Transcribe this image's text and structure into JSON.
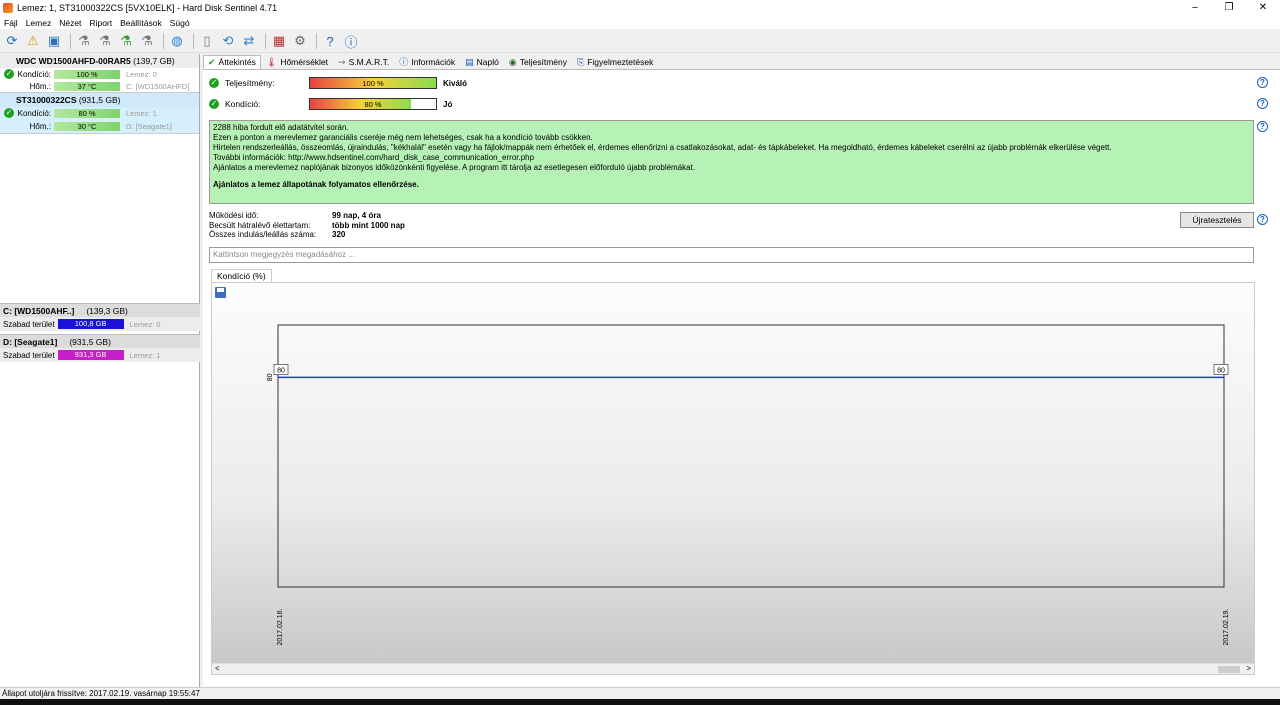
{
  "window": {
    "title": "Lemez: 1, ST31000322CS [5VX10ELK]  -  Hard Disk Sentinel 4.71",
    "minimize": "–",
    "maximize": "❐",
    "close": "✕"
  },
  "menu": [
    "Fájl",
    "Lemez",
    "Nézet",
    "Riport",
    "Beállítások",
    "Súgó"
  ],
  "toolbar_icons": [
    "refresh-icon",
    "disk-warning-icon",
    "report-icon",
    "test-icon-1",
    "test-icon-2",
    "test-icon-3",
    "test-icon-4",
    "globe-icon",
    "document-icon",
    "backup-icon",
    "sync-icon",
    "monitor-icon",
    "settings-icon",
    "help-icon",
    "info-icon"
  ],
  "disks": [
    {
      "name": "WDC WD1500AHFD-00RAR5",
      "size": "(139,7 GB)",
      "health_label": "Kondíció:",
      "health": "100 %",
      "disk_no": "Lemez: 0",
      "temp_label": "Hőm.:",
      "temp": "37 °C",
      "part": "C: [WD1500AHFD]",
      "health_pct": 100
    },
    {
      "name": "ST31000322CS",
      "size": "(931,5 GB)",
      "health_label": "Kondíció:",
      "health": "80 %",
      "disk_no": "Lemez: 1",
      "temp_label": "Hőm.:",
      "temp": "30 °C",
      "part": "D: [Seagate1]",
      "health_pct": 80
    }
  ],
  "partitions": [
    {
      "name": "C: [WD1500AHF..]",
      "size": "(139,3 GB)",
      "free_label": "Szabad terület",
      "free": "100,8 GB",
      "disk_no": "Lemez: 0",
      "color": "#1a12d6"
    },
    {
      "name": "D: [Seagate1]",
      "size": "(931,5 GB)",
      "free_label": "Szabad terület",
      "free": "931,3 GB",
      "disk_no": "Lemez: 1",
      "color": "#c81ec8"
    }
  ],
  "tabs": [
    {
      "label": "Áttekintés",
      "icon": "✔",
      "icon_name": "check-icon"
    },
    {
      "label": "Hőmérséklet",
      "icon": "🌡",
      "icon_name": "thermometer-icon"
    },
    {
      "label": "S.M.A.R.T.",
      "icon": "⇝",
      "icon_name": "smart-icon"
    },
    {
      "label": "Információk",
      "icon": "ⓘ",
      "icon_name": "info-icon"
    },
    {
      "label": "Napló",
      "icon": "▤",
      "icon_name": "log-icon"
    },
    {
      "label": "Teljesítmény",
      "icon": "◉",
      "icon_name": "performance-icon"
    },
    {
      "label": "Figyelmeztetések",
      "icon": "⎘",
      "icon_name": "alerts-icon"
    }
  ],
  "overview": {
    "performance_label": "Teljesítmény:",
    "performance_value": "100 %",
    "performance_pct": 100,
    "performance_rating": "Kiváló",
    "health_label": "Kondíció:",
    "health_value": "80 %",
    "health_pct": 80,
    "health_rating": "Jó",
    "message_lines": [
      "2288 hiba fordult elő adatátvitel során.",
      "Ezen a ponton a merevlemez garanciális cseréje még nem lehetséges, csak ha a kondíció tovább csökken.",
      "Hirtelen rendszerleállás, összeomlás, újraindulás, \"kékhalál\" esetén vagy ha fájlok/mappák nem érhetőek el, érdemes ellenőrizni a csatlakozásokat, adat- és tápkábeleket. Ha megoldható, érdemes kábeleket cserélni az újabb problémák elkerülése végett.",
      "További információk: http://www.hdsentinel.com/hard_disk_case_communication_error.php",
      "Ajánlatos a merevlemez naplójának bizonyos időközönkénti figyelése. A program itt tárolja az esetlegesen előforduló újabb problémákat."
    ],
    "message_bold": "Ajánlatos a lemez állapotának folyamatos ellenőrzése.",
    "info": [
      {
        "key": "Működési idő:",
        "value": "99 nap, 4 óra"
      },
      {
        "key": "Becsült hátralévő élettartam:",
        "value": "több mint 1000 nap"
      },
      {
        "key": "Összes indulás/leállás száma:",
        "value": "320"
      }
    ],
    "retest_label": "Újratesztelés",
    "note_placeholder": "Kattintson megjegyzés megadásához ..."
  },
  "chart_data": {
    "type": "line",
    "tab_label": "Kondíció  (%)",
    "x": [
      "2017.02.16.",
      "2017.02.19."
    ],
    "series": [
      {
        "values": [
          80,
          80
        ]
      }
    ],
    "y_axis_label": "80",
    "ylim": [
      0,
      100
    ],
    "point_labels": [
      "80",
      "80"
    ],
    "line_color": "#1a3fc8"
  },
  "status": "Állapot utoljára frissítve: 2017.02.19. vasárnap 19:55:47",
  "scroll": {
    "left": "<",
    "right": ">"
  }
}
